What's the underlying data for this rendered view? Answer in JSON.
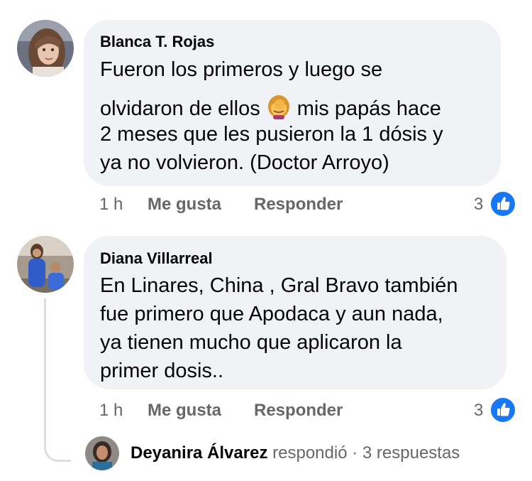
{
  "comments": [
    {
      "author": "Blanca T. Rojas",
      "lines": [
        "Fueron los primeros y luego se",
        "olvidaron de ellos",
        "mis papás hace",
        "2 meses que les pusieron la 1 dósis y",
        "ya no volvieron.  (Doctor Arroyo)"
      ],
      "emoji": "face-palm-emoji",
      "time": "1 h",
      "like_label": "Me gusta",
      "reply_label": "Responder",
      "reaction_count": "3",
      "reaction_icon": "thumbs-up-icon"
    },
    {
      "author": "Diana Villarreal",
      "lines": [
        "En Linares, China , Gral Bravo también",
        "fue primero que Apodaca y aun nada,",
        "ya tienen mucho que aplicaron la",
        "primer dosis.."
      ],
      "time": "1 h",
      "like_label": "Me gusta",
      "reply_label": "Responder",
      "reaction_count": "3",
      "reaction_icon": "thumbs-up-icon"
    }
  ],
  "reply_summary": {
    "name": "Deyanira Álvarez",
    "action": "respondió",
    "separator": "·",
    "count_text": "3 respuestas"
  },
  "colors": {
    "bubble": "#f0f2f5",
    "meta_text": "#65676b",
    "like_blue": "#1877f2"
  }
}
